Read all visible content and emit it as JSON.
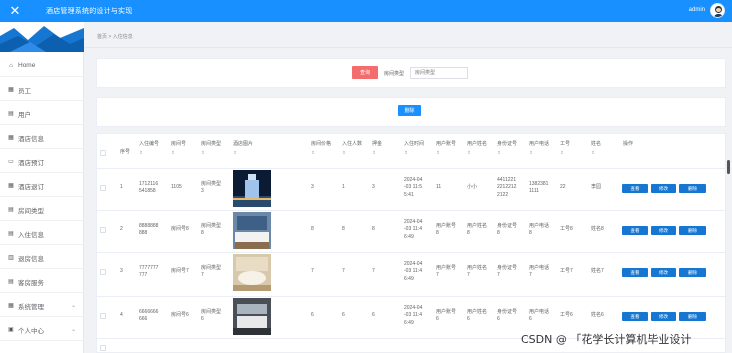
{
  "app": {
    "title": "酒店管理系统的设计与实现",
    "user": "admin",
    "close_icon": "close-icon",
    "accent": "#1890ff"
  },
  "sidebar": {
    "items": [
      {
        "label": "Home",
        "icon": "home-icon"
      },
      {
        "label": "员工",
        "icon": "grid-icon"
      },
      {
        "label": "用户",
        "icon": "user-icon"
      },
      {
        "label": "酒店信息",
        "icon": "grid-icon"
      },
      {
        "label": "酒店预订",
        "icon": "monitor-icon"
      },
      {
        "label": "酒店退订",
        "icon": "grid-icon"
      },
      {
        "label": "房间类型",
        "icon": "doc-icon"
      },
      {
        "label": "入住信息",
        "icon": "doc-icon"
      },
      {
        "label": "退房信息",
        "icon": "chart-icon"
      },
      {
        "label": "客房服务",
        "icon": "doc-icon"
      },
      {
        "label": "系统管理",
        "icon": "grid-icon",
        "expandable": true
      },
      {
        "label": "个人中心",
        "icon": "form-icon",
        "expandable": true
      }
    ]
  },
  "breadcrumb": {
    "text": "首页 > 入住信息"
  },
  "search": {
    "button": "查询",
    "label": "房间类型",
    "placeholder": "房间类型"
  },
  "actions": {
    "delete": "删除"
  },
  "table": {
    "headers": [
      "序号",
      "入住编号",
      "房间号",
      "房间类型",
      "酒店图片",
      "房间价格",
      "入住人数",
      "押金",
      "入住时间",
      "用户账号",
      "用户姓名",
      "身份证号",
      "用户电话",
      "工号",
      "姓名",
      "操作"
    ],
    "sort_icon": "⇕",
    "rows": [
      {
        "index": "1",
        "code": [
          "1712116",
          "541858"
        ],
        "room": "1105",
        "type": [
          "房间类型",
          "3"
        ],
        "price": "3",
        "people": "1",
        "deposit": "3",
        "time": [
          "2024-04",
          "-03 11:5",
          "5:41"
        ],
        "account": "11",
        "name": "小小",
        "id": [
          "4411221",
          "2212212",
          "2122"
        ],
        "phone": [
          "1382381",
          "1111"
        ],
        "jobno": "22",
        "staff": "李园"
      },
      {
        "index": "2",
        "code": [
          "8888888",
          "888"
        ],
        "room": "房间号8",
        "type": [
          "房间类型",
          "8"
        ],
        "price": "8",
        "people": "8",
        "deposit": "8",
        "time": [
          "2024-04",
          "-03 11:4",
          "6:49"
        ],
        "account": [
          "用户账号",
          "8"
        ],
        "name": [
          "用户姓名",
          "8"
        ],
        "id": [
          "身份证号",
          "8"
        ],
        "phone": [
          "用户电话",
          "8"
        ],
        "jobno": "工号8",
        "staff": "姓名8"
      },
      {
        "index": "3",
        "code": [
          "7777777",
          "777"
        ],
        "room": "房间号7",
        "type": [
          "房间类型",
          "7"
        ],
        "price": "7",
        "people": "7",
        "deposit": "7",
        "time": [
          "2024-04",
          "-03 11:4",
          "6:49"
        ],
        "account": [
          "用户账号",
          "7"
        ],
        "name": [
          "用户姓名",
          "7"
        ],
        "id": [
          "身份证号",
          "7"
        ],
        "phone": [
          "用户电话",
          "7"
        ],
        "jobno": "工号7",
        "staff": "姓名7"
      },
      {
        "index": "4",
        "code": [
          "6666666",
          "666"
        ],
        "room": "房间号6",
        "type": [
          "房间类型",
          "6"
        ],
        "price": "6",
        "people": "6",
        "deposit": "6",
        "time": [
          "2024-04",
          "-03 11:4",
          "6:49"
        ],
        "account": [
          "用户账号",
          "6"
        ],
        "name": [
          "用户姓名",
          "6"
        ],
        "id": [
          "身份证号",
          "6"
        ],
        "phone": [
          "用户电话",
          "6"
        ],
        "jobno": "工号6",
        "staff": "姓名6"
      }
    ],
    "row_actions": {
      "view": "查看",
      "edit": "修改",
      "delete": "删除"
    }
  },
  "watermark": "CSDN @ 「花学长计算机毕业设计"
}
